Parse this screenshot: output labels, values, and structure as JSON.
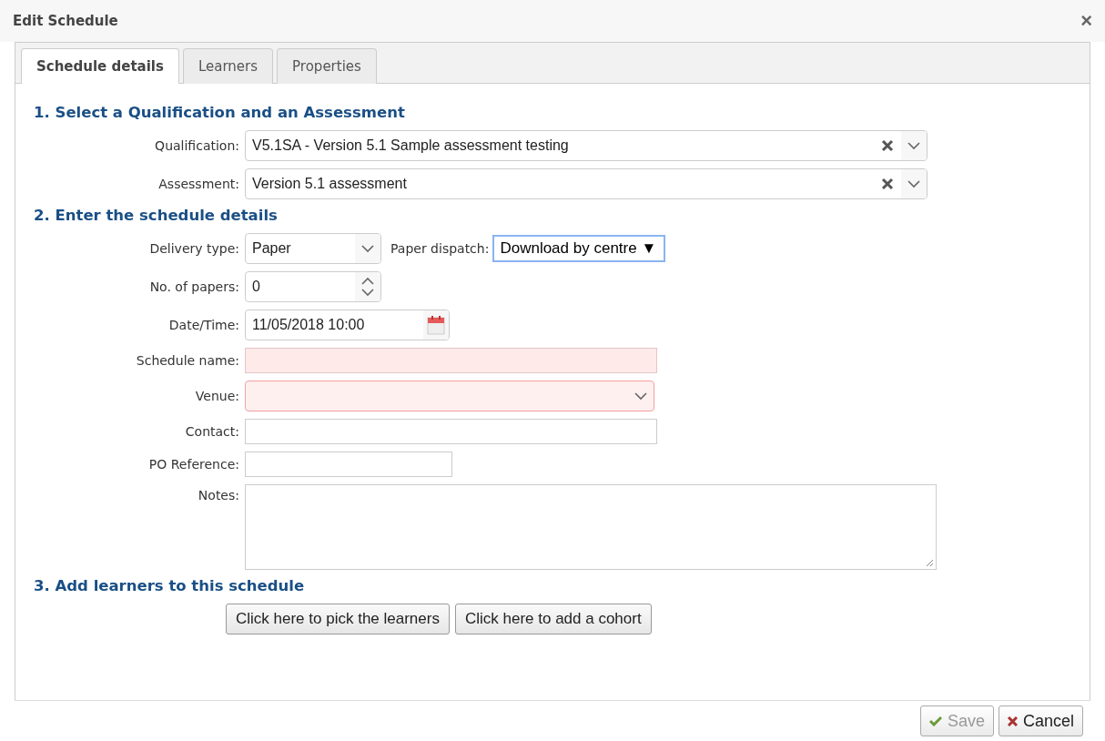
{
  "window": {
    "title": "Edit Schedule",
    "close": "×"
  },
  "tabs": [
    {
      "label": "Schedule details",
      "selected": true
    },
    {
      "label": "Learners",
      "selected": false
    },
    {
      "label": "Properties",
      "selected": false
    }
  ],
  "sections": [
    {
      "heading": "1. Select a Qualification and an Assessment",
      "fields": [
        {
          "kind": "combo",
          "label": "Qualification:",
          "value": "V5.1SA - Version 5.1 Sample assessment testing",
          "invalid": false
        },
        {
          "kind": "combo",
          "label": "Assessment:",
          "value": "Version 5.1 assessment",
          "invalid": false
        }
      ]
    },
    {
      "heading": "2. Enter the schedule details",
      "fields": [
        {
          "kind": "select",
          "label": "Delivery type:",
          "value": "Paper",
          "invalid": false,
          "extra": {
            "label": "Paper dispatch:",
            "value": "Download by centre",
            "arrow": "▼"
          }
        },
        {
          "kind": "spinner",
          "label": "No. of papers:",
          "value": "0",
          "invalid": false
        },
        {
          "kind": "date",
          "label": "Date/Time:",
          "value": "11/05/2018 10:00",
          "invalid": false
        },
        {
          "kind": "text",
          "label": "Schedule name:",
          "invalid": true
        },
        {
          "kind": "select",
          "label": "Venue:",
          "invalid": true
        },
        {
          "kind": "text",
          "label": "Contact:",
          "invalid": false
        },
        {
          "kind": "short",
          "label": "PO Reference:",
          "invalid": false
        },
        {
          "kind": "textarea",
          "label": "Notes:",
          "invalid": false
        }
      ]
    },
    {
      "heading": "3. Add learners to this schedule",
      "buttons": [
        "Click here to pick the learners",
        "Click here to add a cohort"
      ]
    }
  ],
  "footer": [
    {
      "kind": "save",
      "label": "Save",
      "disabled": true
    },
    {
      "kind": "cancel",
      "label": "Cancel",
      "disabled": false
    }
  ]
}
